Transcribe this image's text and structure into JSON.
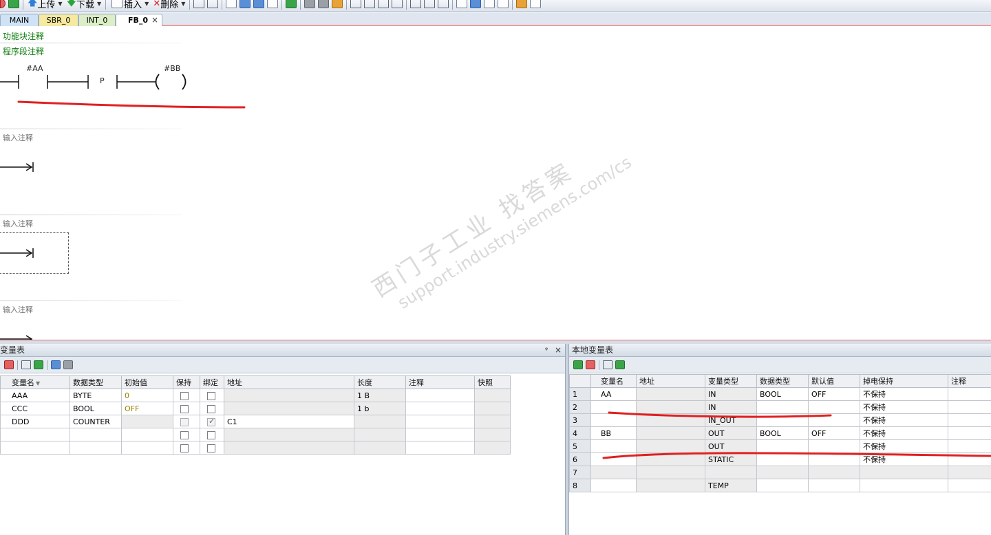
{
  "toolbar": {
    "upload_label": "上传",
    "download_label": "下载",
    "insert_label": "插入",
    "delete_label": "删除"
  },
  "tabs": [
    {
      "label": "MAIN"
    },
    {
      "label": "SBR_0"
    },
    {
      "label": "INT_0"
    },
    {
      "label": "FB_0"
    }
  ],
  "tab_close": "×",
  "editor": {
    "block_comment": "功能块注释",
    "network_comment": "程序段注释",
    "contact_operand": "#AA",
    "edge_label": "P",
    "coil_operand": "#BB",
    "input_comment_1": "输入注释",
    "input_comment_2": "输入注释",
    "input_comment_3": "输入注释"
  },
  "watermark": {
    "line1": "西门子工业  找答案",
    "line2": "support.industry.siemens.com/cs"
  },
  "left_pane": {
    "title": "变量表",
    "pin": "ᵠ",
    "close": "×",
    "columns": [
      "变量名",
      "数据类型",
      "初始值",
      "保持",
      "绑定",
      "地址",
      "长度",
      "注释",
      "快照"
    ],
    "rows": [
      {
        "name": "AAA",
        "type": "BYTE",
        "init": "0",
        "retain": false,
        "bind": false,
        "addr": "",
        "len": "1 B",
        "comment": "",
        "snap": ""
      },
      {
        "name": "CCC",
        "type": "BOOL",
        "init": "OFF",
        "retain": false,
        "bind": false,
        "addr": "",
        "len": "1 b",
        "comment": "",
        "snap": ""
      },
      {
        "name": "DDD",
        "type": "COUNTER",
        "init": "",
        "retain": false,
        "bind": true,
        "addr": "C1",
        "len": "",
        "comment": "",
        "snap": ""
      },
      {
        "name": "",
        "type": "",
        "init": "",
        "retain": false,
        "bind": false,
        "addr": "",
        "len": "",
        "comment": "",
        "snap": ""
      },
      {
        "name": "",
        "type": "",
        "init": "",
        "retain": false,
        "bind": false,
        "addr": "",
        "len": "",
        "comment": "",
        "snap": ""
      }
    ]
  },
  "right_pane": {
    "title": "本地变量表",
    "columns": [
      "",
      "变量名",
      "地址",
      "变量类型",
      "数据类型",
      "默认值",
      "掉电保持",
      "注释"
    ],
    "rows": [
      {
        "num": "1",
        "name": "AA",
        "addr": "",
        "vartype": "IN",
        "dtype": "BOOL",
        "default": "OFF",
        "retain": "不保持",
        "comment": ""
      },
      {
        "num": "2",
        "name": "",
        "addr": "",
        "vartype": "IN",
        "dtype": "",
        "default": "",
        "retain": "不保持",
        "comment": ""
      },
      {
        "num": "3",
        "name": "",
        "addr": "",
        "vartype": "IN_OUT",
        "dtype": "",
        "default": "",
        "retain": "不保持",
        "comment": ""
      },
      {
        "num": "4",
        "name": "BB",
        "addr": "",
        "vartype": "OUT",
        "dtype": "BOOL",
        "default": "OFF",
        "retain": "不保持",
        "comment": ""
      },
      {
        "num": "5",
        "name": "",
        "addr": "",
        "vartype": "OUT",
        "dtype": "",
        "default": "",
        "retain": "不保持",
        "comment": ""
      },
      {
        "num": "6",
        "name": "",
        "addr": "",
        "vartype": "STATIC",
        "dtype": "",
        "default": "",
        "retain": "不保持",
        "comment": ""
      },
      {
        "num": "7",
        "name": "",
        "addr": "",
        "vartype": "",
        "dtype": "",
        "default": "",
        "retain": "",
        "comment": ""
      },
      {
        "num": "8",
        "name": "",
        "addr": "",
        "vartype": "TEMP",
        "dtype": "",
        "default": "",
        "retain": "",
        "comment": ""
      }
    ]
  },
  "colors": {
    "annotation_red": "#e02020",
    "comment_green": "#0a7a0a"
  }
}
